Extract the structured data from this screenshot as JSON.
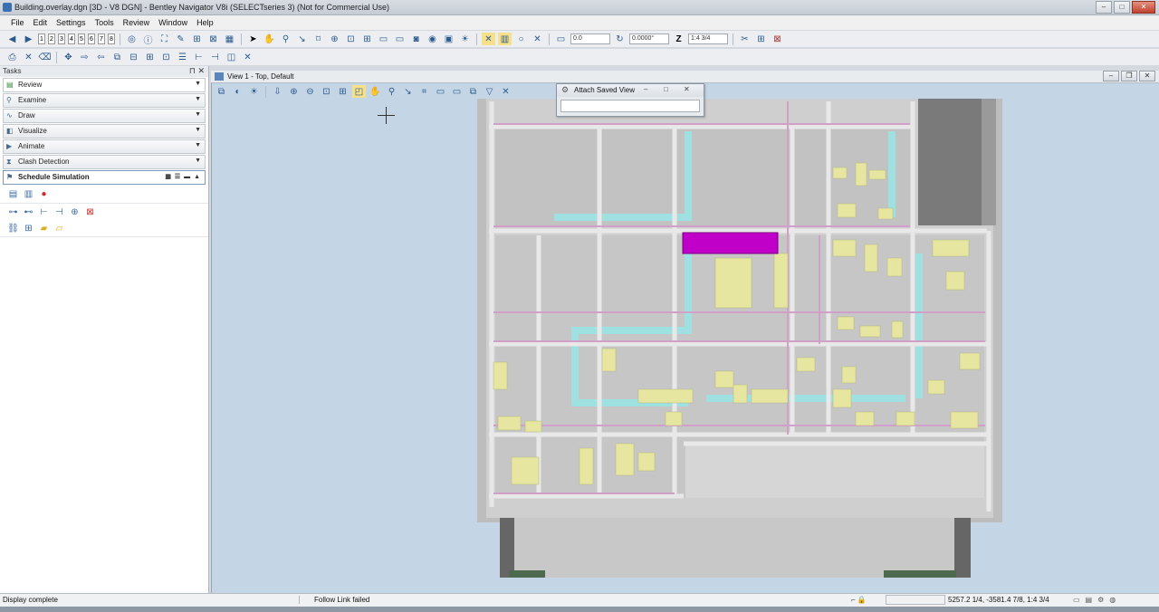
{
  "window": {
    "title": "Building.overlay.dgn [3D - V8 DGN] - Bentley Navigator V8i (SELECTseries 3) (Not for Commercial Use)"
  },
  "menu": [
    "File",
    "Edit",
    "Settings",
    "Tools",
    "Review",
    "Window",
    "Help"
  ],
  "toolbar": {
    "views": [
      "1",
      "2",
      "3",
      "4",
      "5",
      "6",
      "7",
      "8"
    ],
    "angle_value": "0.0",
    "rotation_value": "0.0000°",
    "z_label": "Z",
    "z_value": "1:4 3/4"
  },
  "tasks": {
    "header": "Tasks",
    "current": "Review",
    "items": [
      "Examine",
      "Draw",
      "Visualize",
      "Animate",
      "Clash Detection"
    ],
    "active_item": "Schedule Simulation"
  },
  "view": {
    "title": "View 1 - Top, Default"
  },
  "attach_dialog": {
    "title": "Attach Saved View"
  },
  "status": {
    "left": "Display complete",
    "middle": "Follow Link failed",
    "coords": "5257.2 1/4, -3581.4 7/8, 1:4 3/4"
  },
  "colors": {
    "highlight": "#c000c8",
    "duct": "#9fe0e0",
    "pipe": "#c8a0c0",
    "equipment": "#e6e6a0",
    "wall": "#c8c8c8",
    "background": "#c4d6e5"
  }
}
